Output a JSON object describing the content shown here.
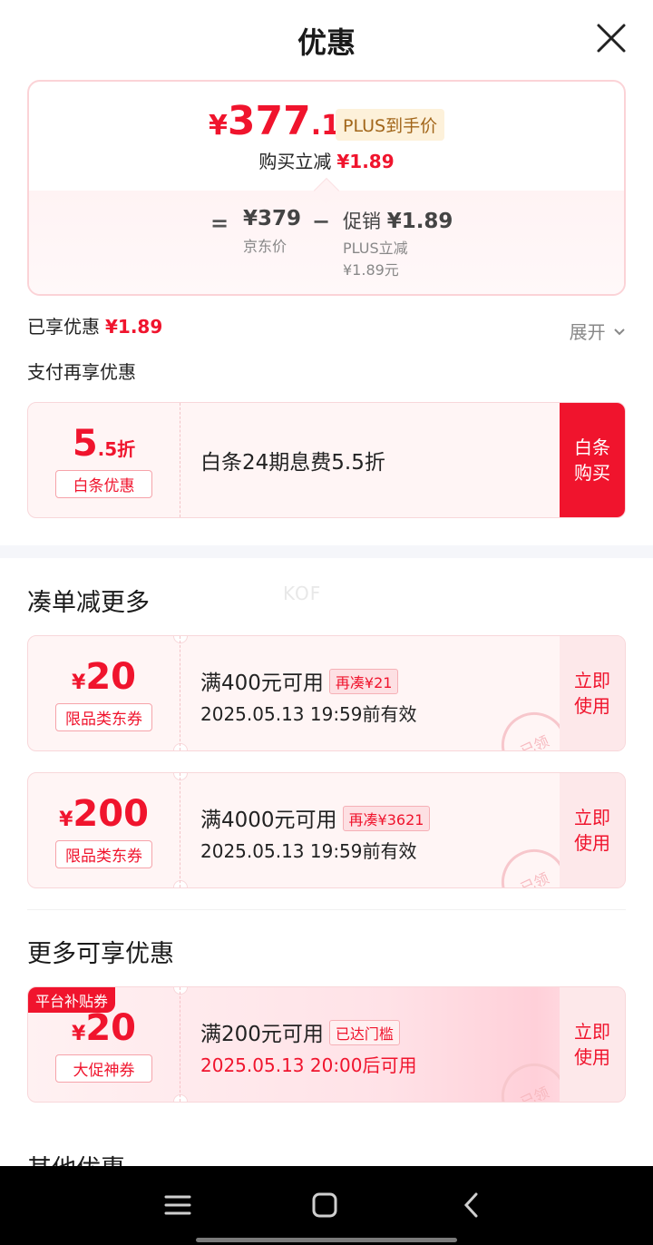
{
  "header": {
    "title": "优惠"
  },
  "price_card": {
    "currency": "¥",
    "final_int": "377",
    "final_dec": ".11",
    "plus_tag": "PLUS到手价",
    "reduce_label": "购买立减",
    "reduce_amount": "¥1.89",
    "eq_sign": "=",
    "jd_price": "¥379",
    "jd_price_label": "京东价",
    "minus_sign": "−",
    "promo_label": "促销",
    "promo_amount": "¥1.89",
    "plus_reduce_label": "PLUS立减",
    "plus_reduce_amount": "¥1.89元"
  },
  "enjoyed": {
    "label": "已享优惠",
    "amount": "¥1.89",
    "expand_label": "展开"
  },
  "pay_section": {
    "title": "支付再享优惠",
    "coupon": {
      "amount_big": "5",
      "amount_small": ".5折",
      "type": "白条优惠",
      "desc": "白条24期息费5.5折",
      "action": "白条\n购买"
    }
  },
  "watermark": "KOF",
  "combine_section": {
    "title": "凑单减更多",
    "coupons": [
      {
        "currency": "¥",
        "amount": "20",
        "type": "限品类东券",
        "condition": "满400元可用",
        "gap": "再凑¥21",
        "validity": "2025.05.13 19:59前有效",
        "action": "立即\n使用",
        "stamp": "已领"
      },
      {
        "currency": "¥",
        "amount": "200",
        "type": "限品类东券",
        "condition": "满4000元可用",
        "gap": "再凑¥3621",
        "validity": "2025.05.13 19:59前有效",
        "action": "立即\n使用",
        "stamp": "已领"
      }
    ]
  },
  "more_section": {
    "title": "更多可享优惠",
    "coupon": {
      "corner": "平台补贴券",
      "currency": "¥",
      "amount": "20",
      "type": "大促神券",
      "condition": "满200元可用",
      "gap": "已达门槛",
      "validity": "2025.05.13 20:00后可用",
      "action": "立即\n使用",
      "stamp": "已领"
    }
  },
  "other_section": {
    "title": "其他优惠"
  },
  "navbar": {
    "icons": [
      "menu-icon",
      "home-square-icon",
      "back-chevron-icon"
    ]
  },
  "colors": {
    "accent": "#f0142d",
    "plus_gold": "#a2661a",
    "bg_light": "#fff5f5"
  }
}
